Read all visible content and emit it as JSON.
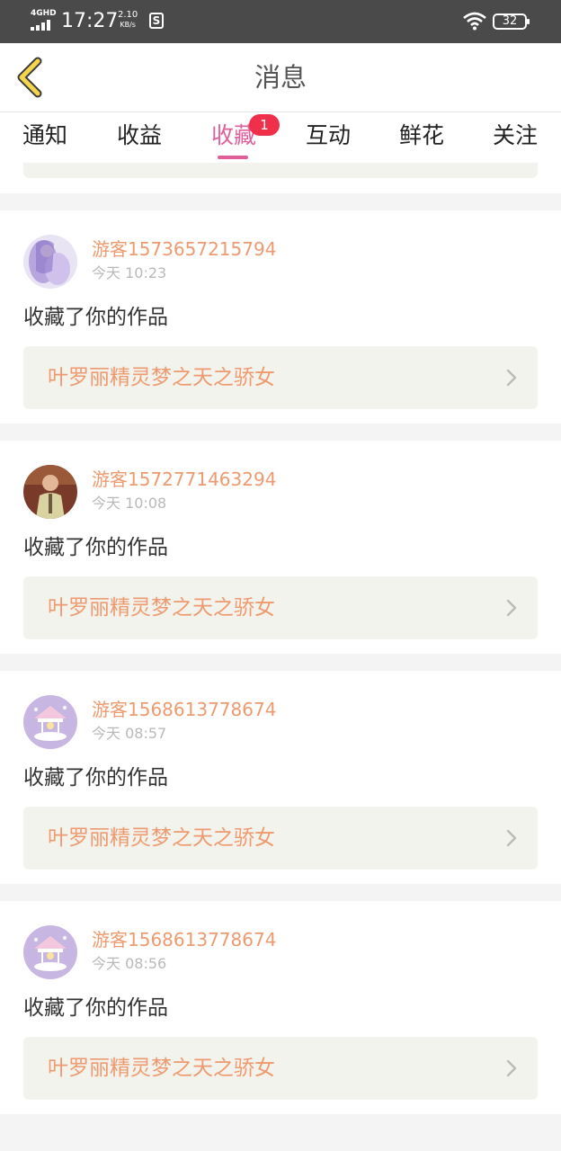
{
  "status_bar": {
    "network": "4GHD",
    "time": "17:27",
    "speed_value": "2.10",
    "speed_unit": "KB/s",
    "app_icon": "S",
    "battery": "32"
  },
  "header": {
    "title": "消息"
  },
  "tabs": [
    {
      "label": "通知"
    },
    {
      "label": "收益"
    },
    {
      "label": "收藏",
      "badge": "1"
    },
    {
      "label": "互动"
    },
    {
      "label": "鲜花"
    },
    {
      "label": "关注"
    }
  ],
  "colors": {
    "accent": "#e05f9b",
    "badge": "#f0304a",
    "username": "#ee9a6e",
    "work_bg": "#f3f3ee"
  },
  "messages": [
    {
      "user": "游客1573657215794",
      "time": "今天 10:23",
      "action": "收藏了你的作品",
      "work": "叶罗丽精灵梦之天之骄女",
      "avatar": "fairy-avatar"
    },
    {
      "user": "游客1572771463294",
      "time": "今天 10:08",
      "action": "收藏了你的作品",
      "work": "叶罗丽精灵梦之天之骄女",
      "avatar": "boy-photo-avatar"
    },
    {
      "user": "游客1568613778674",
      "time": "今天 08:57",
      "action": "收藏了你的作品",
      "work": "叶罗丽精灵梦之天之骄女",
      "avatar": "carousel-avatar"
    },
    {
      "user": "游客1568613778674",
      "time": "今天 08:56",
      "action": "收藏了你的作品",
      "work": "叶罗丽精灵梦之天之骄女",
      "avatar": "carousel-avatar"
    }
  ]
}
